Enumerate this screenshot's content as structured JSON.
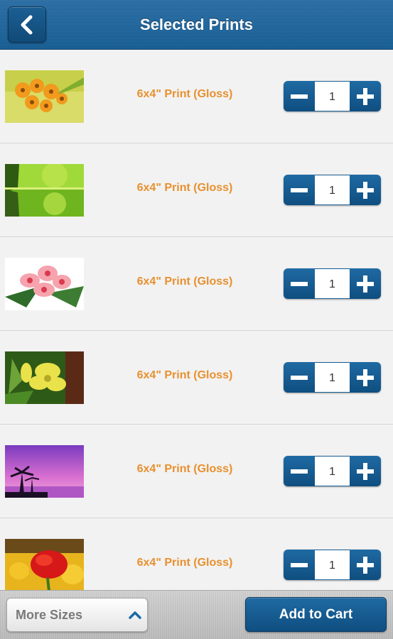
{
  "header": {
    "title": "Selected Prints",
    "back_icon": "chevron-left-icon"
  },
  "prints": [
    {
      "label": "6x4\" Print (Gloss)",
      "quantity": "1",
      "image": "orange-gerbera-flowers"
    },
    {
      "label": "6x4\" Print (Gloss)",
      "quantity": "1",
      "image": "green-forest-lake"
    },
    {
      "label": "6x4\" Print (Gloss)",
      "quantity": "1",
      "image": "pink-lilies"
    },
    {
      "label": "6x4\" Print (Gloss)",
      "quantity": "1",
      "image": "yellow-lily"
    },
    {
      "label": "6x4\" Print (Gloss)",
      "quantity": "1",
      "image": "purple-palm-sunset"
    },
    {
      "label": "6x4\" Print (Gloss)",
      "quantity": "1",
      "image": "red-poppy"
    }
  ],
  "stepper": {
    "minus_icon": "minus-icon",
    "plus_icon": "plus-icon"
  },
  "footer": {
    "more_sizes_label": "More Sizes",
    "more_sizes_icon": "chevron-up-icon",
    "add_to_cart_label": "Add to Cart"
  },
  "colors": {
    "header_blue": "#175e95",
    "button_blue": "#0f4e80",
    "label_orange": "#e8902e"
  }
}
